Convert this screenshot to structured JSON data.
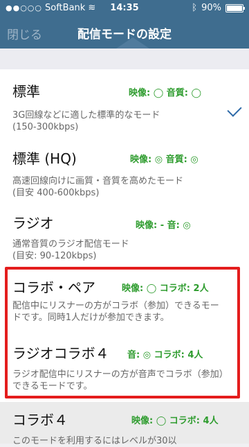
{
  "status": {
    "carrier": "SoftBank",
    "time": "14:35",
    "battery": "90%",
    "battery_level": 0.9
  },
  "nav": {
    "close": "閉じる",
    "title": "配信モードの設定"
  },
  "modes": [
    {
      "name": "標準",
      "spec": "映像: ◯ 音質: ◯",
      "desc": "3G回線などに適した標準的なモード\n(150-300kbps)",
      "selected": true
    },
    {
      "name": "標準 (HQ)",
      "spec": "映像: ◎ 音質: ◎",
      "desc": "高速回線向けに画質・音質を高めたモード\n(目安 400-600kbps)"
    },
    {
      "name": "ラジオ",
      "spec": "映像: -  音: ◎",
      "desc": "通常音質のラジオ配信モード\n(目安: 90-120kbps)"
    },
    {
      "name": "コラボ・ペア",
      "spec": "映像: ◯ コラボ: 2人",
      "desc": "配信中にリスナーの方がコラボ（参加）できるモードです。同時1人だけが参加できます。"
    },
    {
      "name": "ラジオコラボ４",
      "spec": "音: ◎ コラボ: 4人",
      "desc": "ラジオ配信中にリスナーの方が音声でコラボ（参加）できるモードです。"
    },
    {
      "name": "コラボ４",
      "spec": "映像: ◯ コラボ: 4人",
      "desc": "このモードを利用するにはレベルが30以"
    }
  ]
}
